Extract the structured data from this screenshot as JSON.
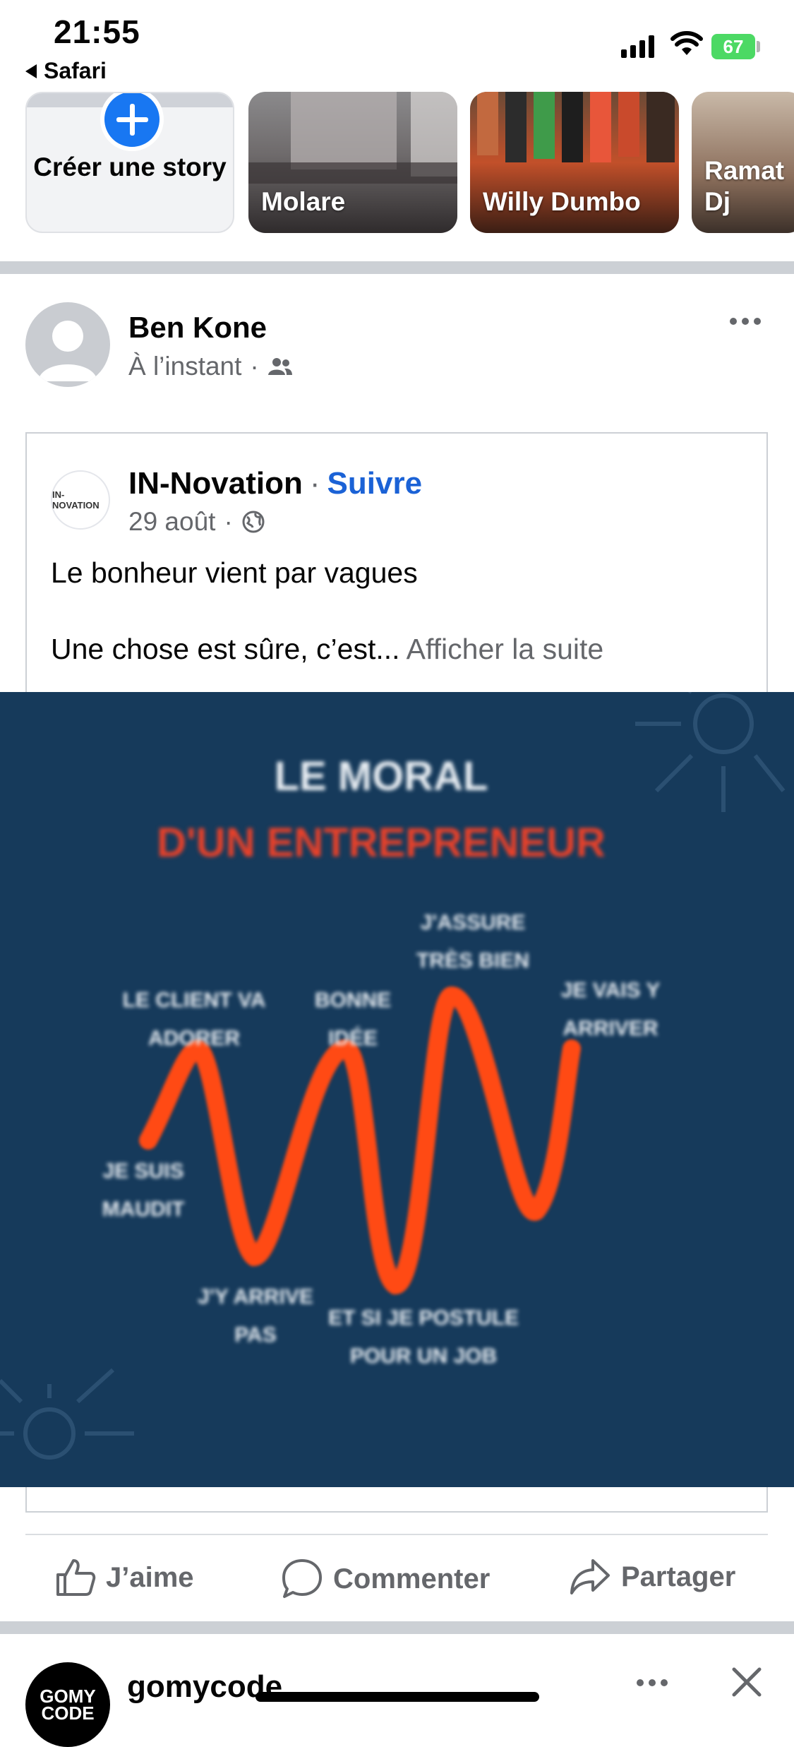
{
  "status_bar": {
    "time": "21:55",
    "back_app": "Safari",
    "battery": "67"
  },
  "stories": {
    "create_label": "Créer une story",
    "items": [
      {
        "name": "Molare"
      },
      {
        "name": "Willy Dumbo"
      },
      {
        "name": "Ramat Dj"
      }
    ]
  },
  "post": {
    "author": "Ben Kone",
    "time": "À l’instant",
    "shared": {
      "page_name": "IN-Novation",
      "follow_label": "Suivre",
      "logo_text": "IN-NOVATION",
      "date": "29 août",
      "text_line1": "Le bonheur vient par vagues",
      "text_line2": "Une chose est sûre, c’est...",
      "see_more": "Afficher la suite",
      "image": {
        "title": "LE MORAL",
        "subtitle": "D'UN ENTREPRENEUR",
        "labels": [
          "JE SUIS MAUDIT",
          "LE CLIENT VA ADORER",
          "J'Y ARRIVE PAS",
          "BONNE IDÉE",
          "ET SI JE POSTULE POUR UN JOB",
          "J'ASSURE TRÈS BIEN",
          "JE VAIS Y ARRIVER"
        ]
      }
    },
    "actions": {
      "like": "J’aime",
      "comment": "Commenter",
      "share": "Partager"
    }
  },
  "next_post": {
    "author": "gomycode",
    "avatar_text": "GOMY CODE"
  },
  "colors": {
    "brand_blue": "#1877f2",
    "follow_blue": "#1b62d6",
    "image_bg": "#163a5b",
    "wave": "#ff4a14"
  }
}
